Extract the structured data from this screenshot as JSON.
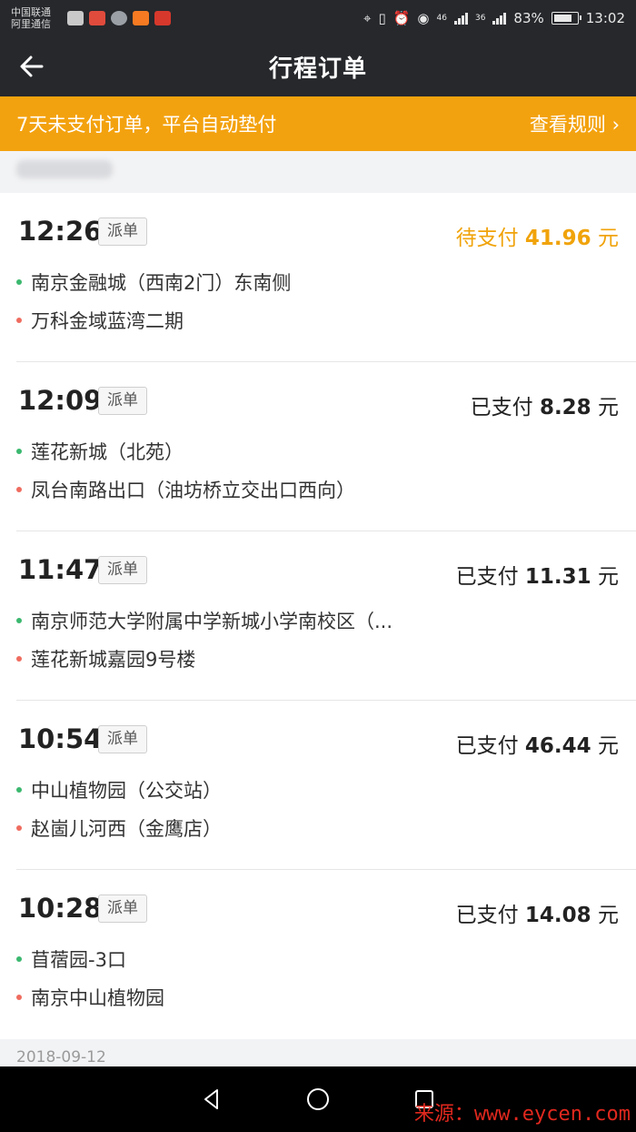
{
  "statusbar": {
    "carrier_line1": "中国联通",
    "carrier_line2": "阿里通信",
    "signal1": "46",
    "signal2": "36",
    "battery": "83%",
    "battery_level": 0.83,
    "time": "13:02"
  },
  "header": {
    "title": "行程订单"
  },
  "banner": {
    "text": "7天未支付订单，平台自动垫付",
    "link": "查看规则 ›"
  },
  "orders": [
    {
      "time": "12:26",
      "tag": "派单",
      "status": "待支付",
      "amount": "41.96",
      "unit": "元",
      "pending": true,
      "from": "南京金融城（西南2门）东南侧",
      "to": "万科金域蓝湾二期"
    },
    {
      "time": "12:09",
      "tag": "派单",
      "status": "已支付",
      "amount": "8.28",
      "unit": "元",
      "pending": false,
      "from": "莲花新城（北苑）",
      "to": "凤台南路出口（油坊桥立交出口西向）"
    },
    {
      "time": "11:47",
      "tag": "派单",
      "status": "已支付",
      "amount": "11.31",
      "unit": "元",
      "pending": false,
      "from": "南京师范大学附属中学新城小学南校区（...",
      "to": "莲花新城嘉园9号楼"
    },
    {
      "time": "10:54",
      "tag": "派单",
      "status": "已支付",
      "amount": "46.44",
      "unit": "元",
      "pending": false,
      "from": "中山植物园（公交站）",
      "to": "赵崮儿河西（金鹰店）"
    },
    {
      "time": "10:28",
      "tag": "派单",
      "status": "已支付",
      "amount": "14.08",
      "unit": "元",
      "pending": false,
      "from": "苜蓿园-3口",
      "to": "南京中山植物园"
    }
  ],
  "footer_date": "2018-09-12",
  "watermark": "来源：www.eycen.com",
  "colors": {
    "accent": "#f3a20f",
    "pending": "#f0a30a",
    "from_dot": "#3bb86f",
    "to_dot": "#ef6c5f"
  }
}
